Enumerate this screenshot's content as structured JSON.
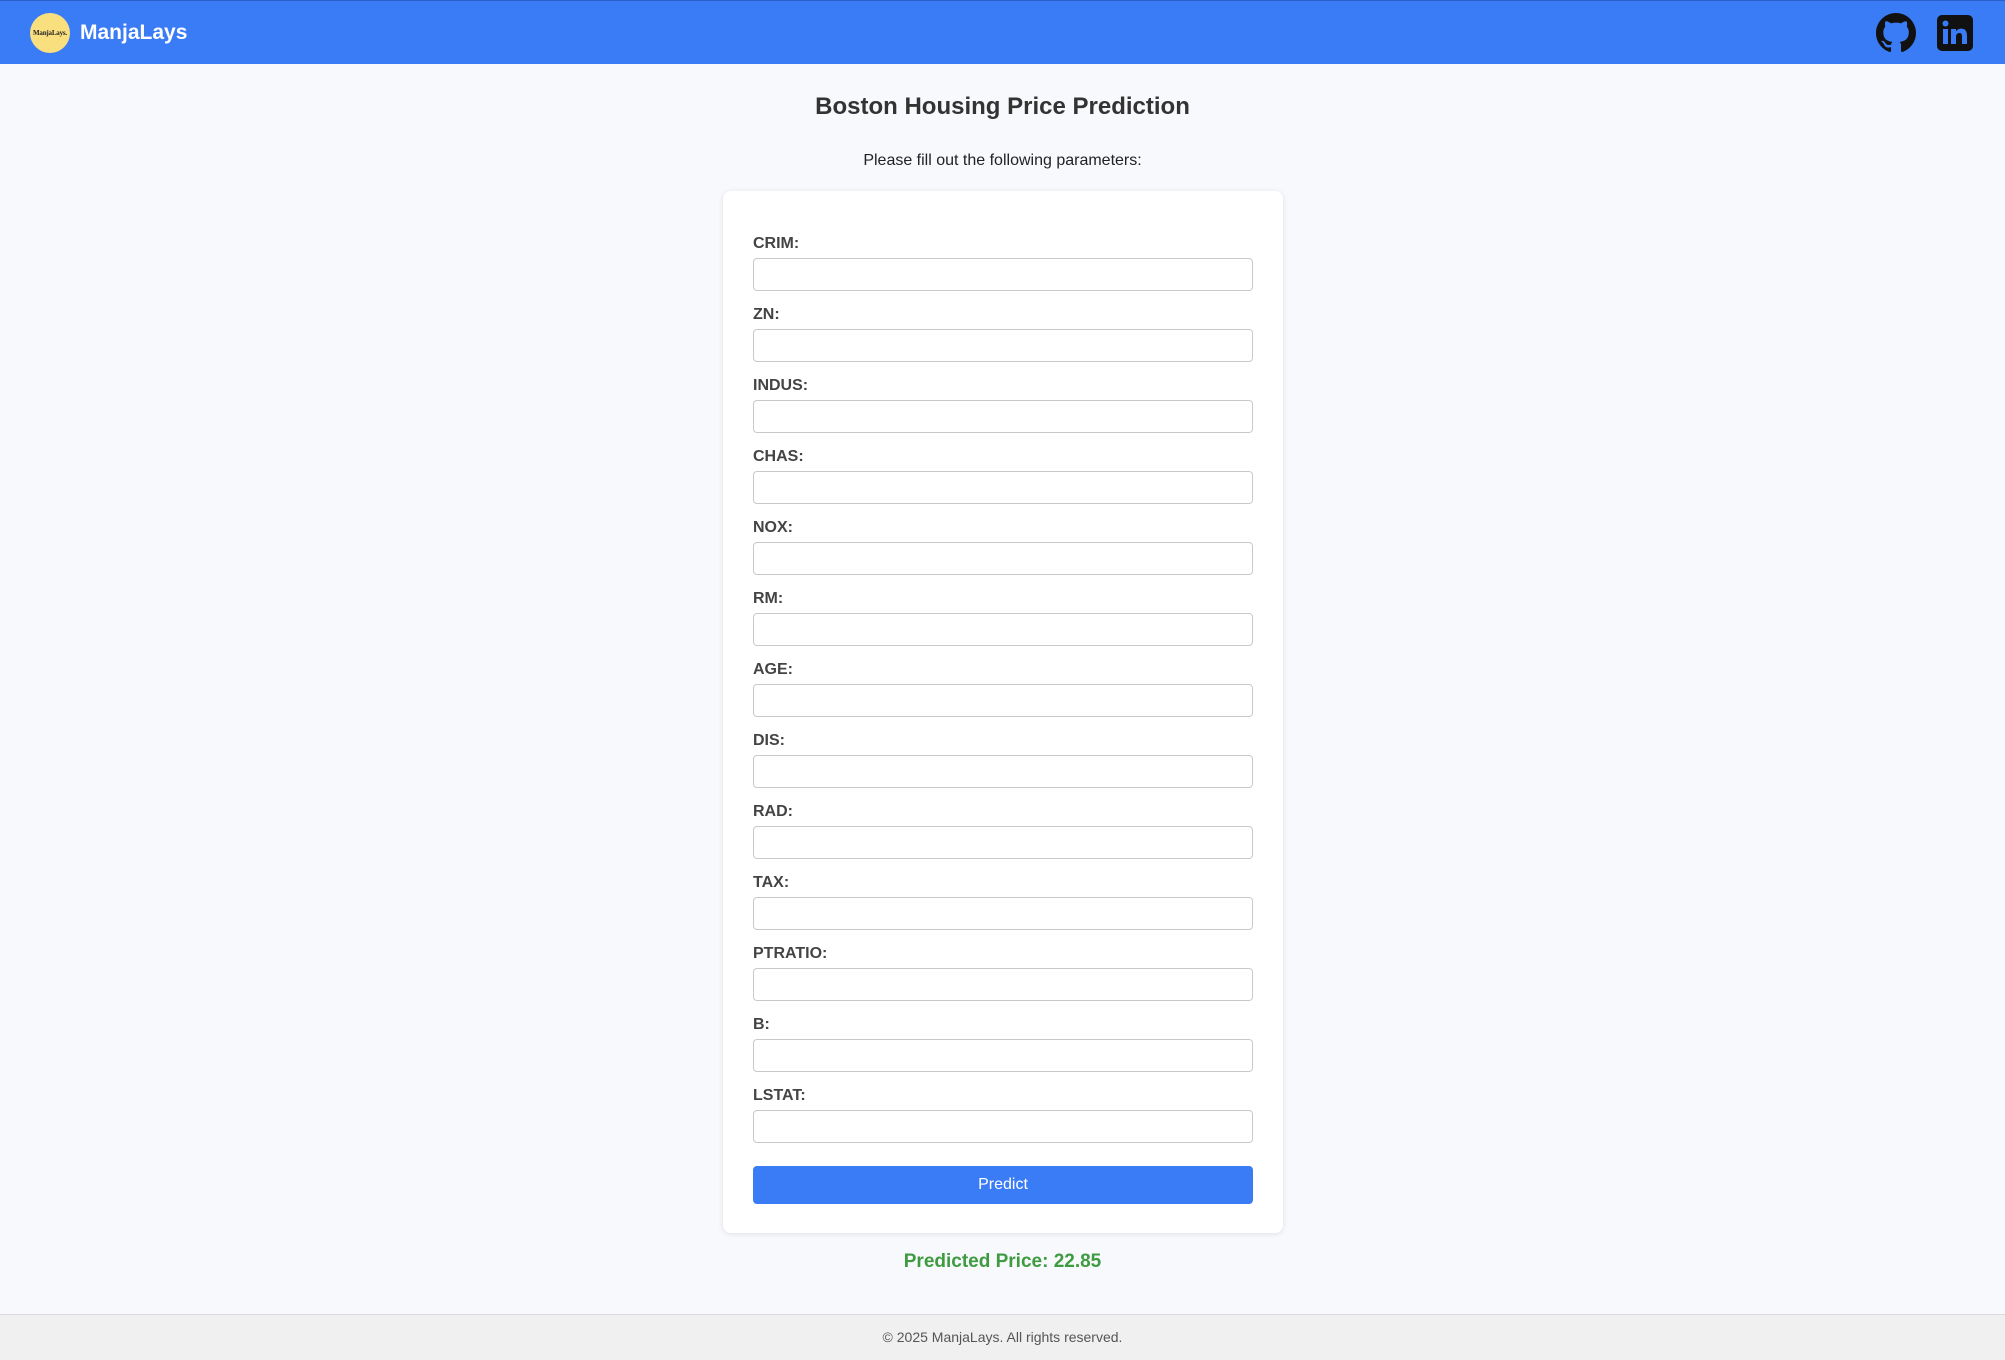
{
  "navbar": {
    "logo_text": "ManjaLays.",
    "brand": "ManjaLays",
    "links": [
      {
        "icon": "github-icon"
      },
      {
        "icon": "linkedin-icon"
      }
    ],
    "colors": {
      "background": "#3a7cf6",
      "logo_background": "#f9df7e"
    }
  },
  "main": {
    "title": "Boston Housing Price Prediction",
    "subtitle": "Please fill out the following parameters:"
  },
  "form": {
    "fields": [
      {
        "label": "CRIM:",
        "value": ""
      },
      {
        "label": "ZN:",
        "value": ""
      },
      {
        "label": "INDUS:",
        "value": ""
      },
      {
        "label": "CHAS:",
        "value": ""
      },
      {
        "label": "NOX:",
        "value": ""
      },
      {
        "label": "RM:",
        "value": ""
      },
      {
        "label": "AGE:",
        "value": ""
      },
      {
        "label": "DIS:",
        "value": ""
      },
      {
        "label": "RAD:",
        "value": ""
      },
      {
        "label": "TAX:",
        "value": ""
      },
      {
        "label": "PTRATIO:",
        "value": ""
      },
      {
        "label": "B:",
        "value": ""
      },
      {
        "label": "LSTAT:",
        "value": ""
      }
    ],
    "submit_label": "Predict"
  },
  "result": {
    "text": "Predicted Price: 22.85",
    "color": "#3f9b3f"
  },
  "footer": {
    "text": "© 2025 ManjaLays. All rights reserved."
  }
}
